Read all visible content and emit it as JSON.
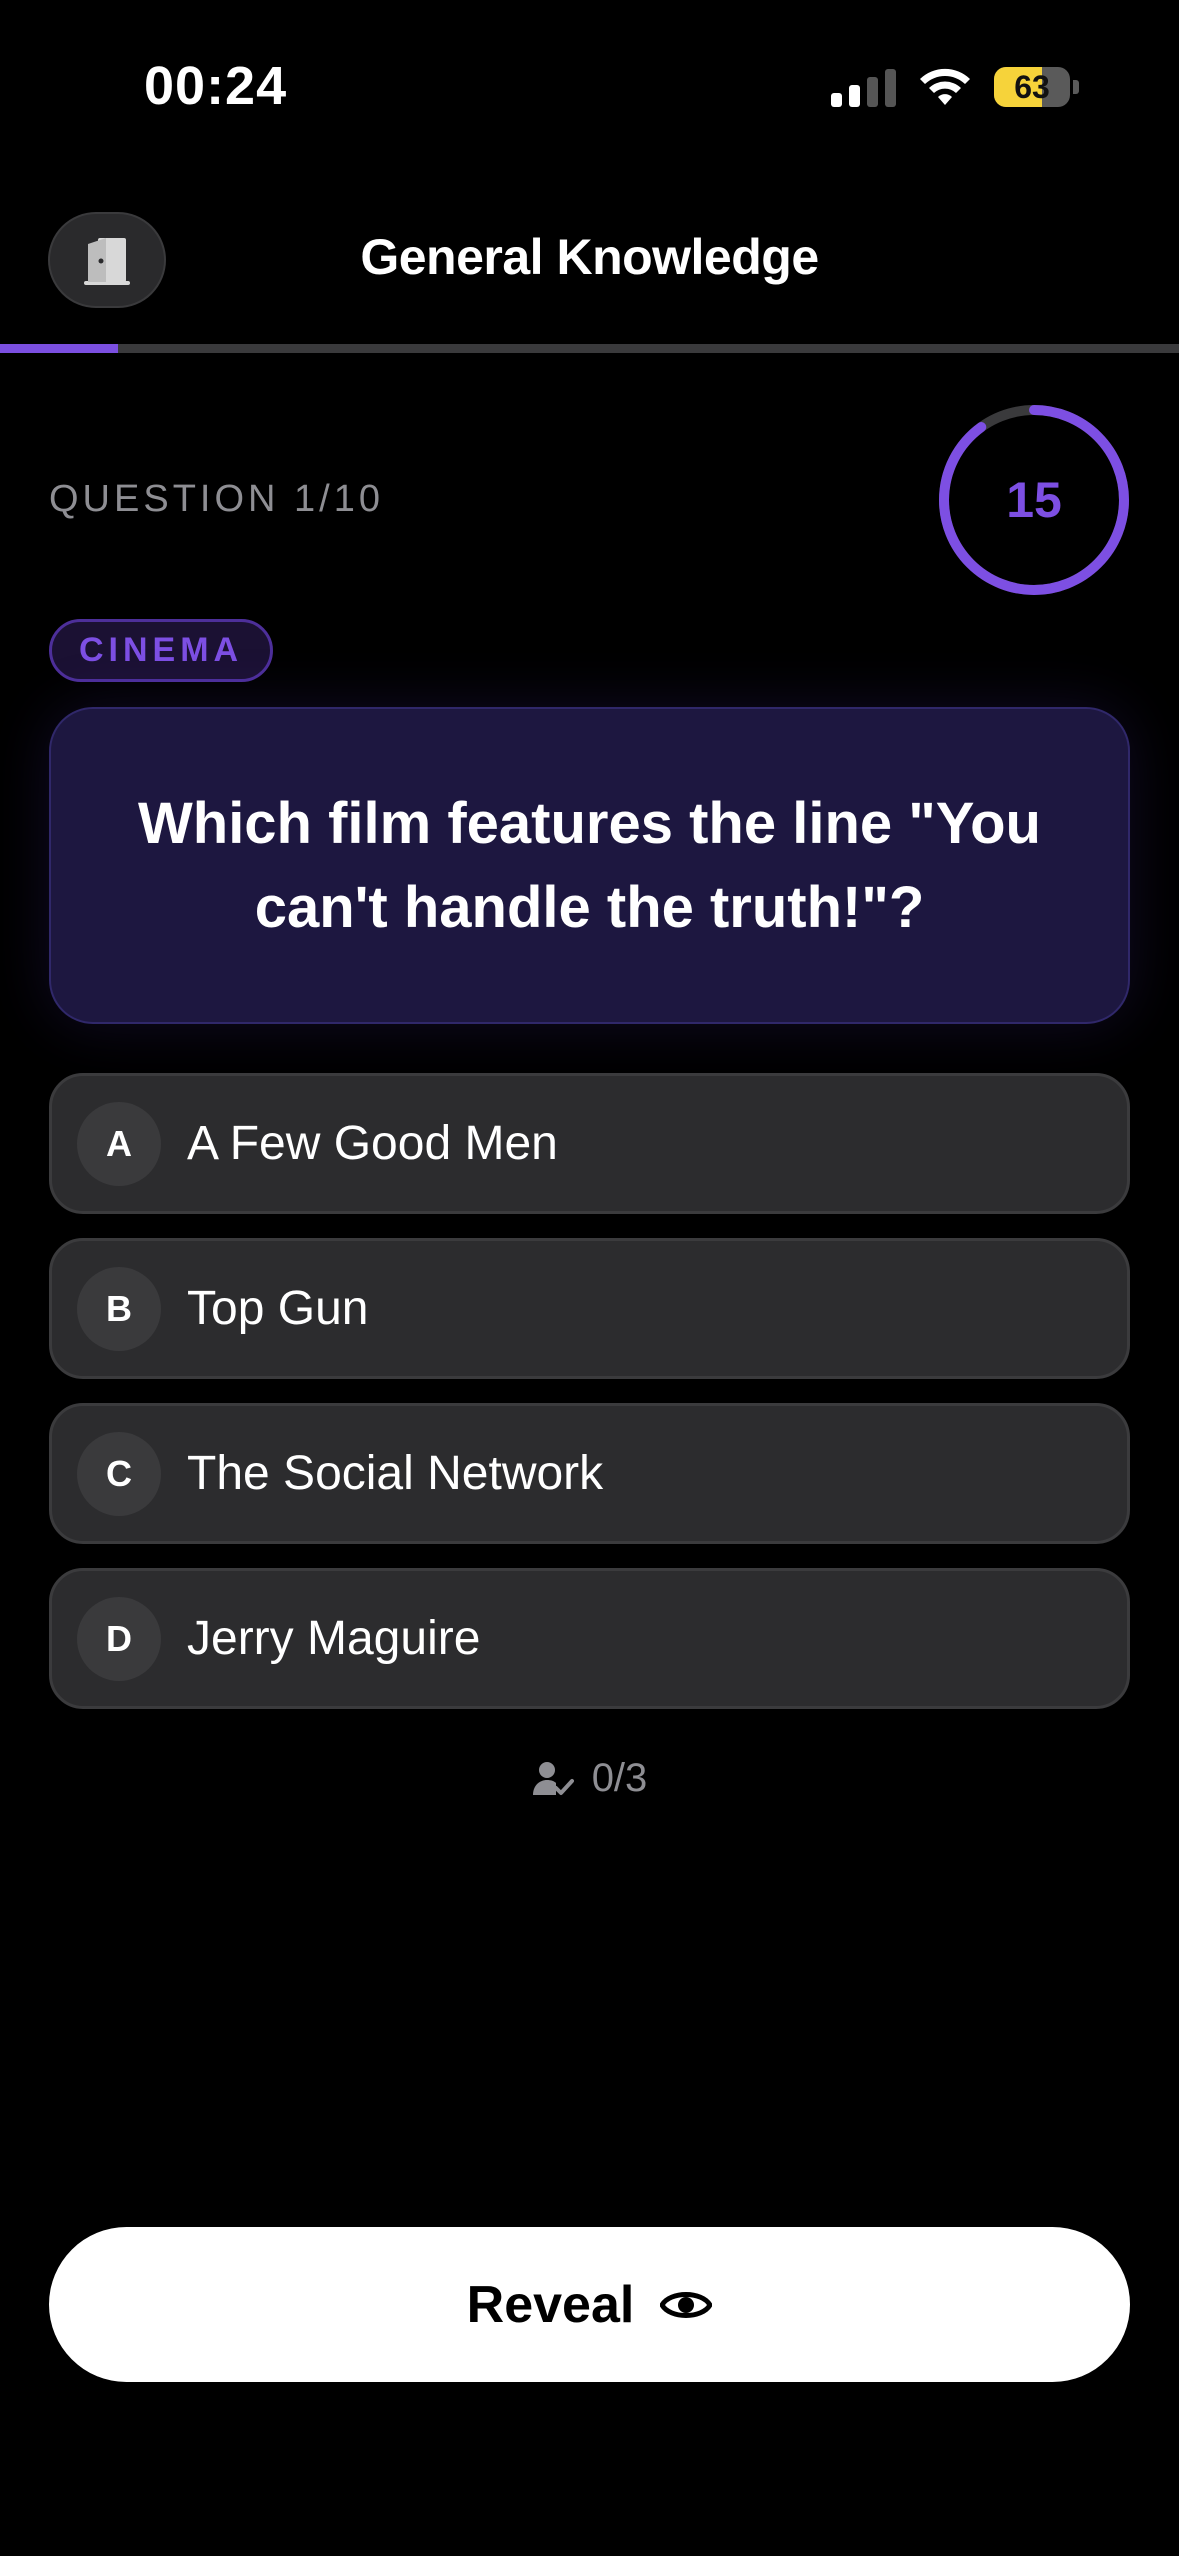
{
  "status_bar": {
    "time": "00:24",
    "battery_percent": "63",
    "battery_level": 0.63,
    "signal_bars_active": 2,
    "signal_bars_total": 4,
    "icons": [
      "cellular-signal-icon",
      "wifi-icon",
      "battery-icon"
    ]
  },
  "header": {
    "title": "General Knowledge",
    "exit_icon": "door-exit-icon"
  },
  "progress": {
    "current": 1,
    "total": 10,
    "fraction": 0.1
  },
  "question": {
    "counter_label": "QUESTION 1/10",
    "category": "CINEMA",
    "text": "Which film features the line \"You can't handle the truth!\"?",
    "timer_seconds": "15",
    "timer_fraction_remaining": 0.9
  },
  "answers": [
    {
      "letter": "A",
      "text": "A Few Good Men"
    },
    {
      "letter": "B",
      "text": "Top Gun"
    },
    {
      "letter": "C",
      "text": "The Social Network"
    },
    {
      "letter": "D",
      "text": "Jerry Maguire"
    }
  ],
  "responders": {
    "icon": "person-check-icon",
    "count_label": "0/3"
  },
  "reveal_button": {
    "label": "Reveal",
    "icon": "eye-icon"
  },
  "colors": {
    "accent": "#7d4fe3",
    "background": "#000000",
    "card": "#1d1740",
    "answer_bg": "#2c2c2e",
    "battery": "#f6d33a"
  }
}
